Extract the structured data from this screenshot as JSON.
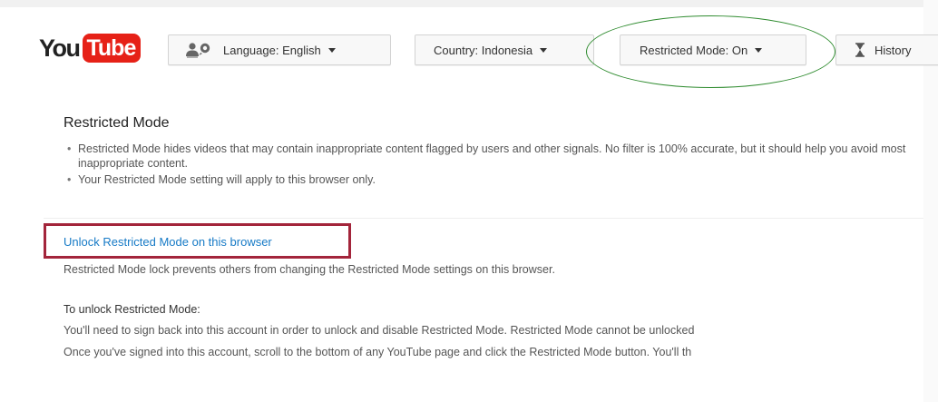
{
  "logo": {
    "you": "You",
    "tube": "Tube"
  },
  "toolbar": {
    "language_label": "Language: English",
    "country_label": "Country: Indonesia",
    "restricted_label": "Restricted Mode: On",
    "history_label": "History"
  },
  "restricted": {
    "title": "Restricted Mode",
    "bullets": [
      "Restricted Mode hides videos that may contain inappropriate content flagged by users and other signals. No filter is 100% accurate, but it should help you avoid most inappropriate content.",
      "Your Restricted Mode setting will apply to this browser only."
    ]
  },
  "lock": {
    "link_label": "Unlock Restricted Mode on this browser",
    "description": "Restricted Mode lock prevents others from changing the Restricted Mode settings on this browser."
  },
  "unlock": {
    "heading": "To unlock Restricted Mode:",
    "line1": "You'll need to sign back into this account in order to unlock and disable Restricted Mode. Restricted Mode cannot be unlocked",
    "line2": "Once you've signed into this account, scroll to the bottom of any YouTube page and click the Restricted Mode button. You'll th"
  },
  "colors": {
    "brand_red": "#e62117",
    "link_blue": "#167ac6",
    "annotation_ellipse": "#2e8b2e",
    "annotation_box": "#a3253b"
  },
  "icons": {
    "language": "people-speech-icon",
    "dropdown": "caret-down-icon",
    "history": "hourglass-icon"
  }
}
